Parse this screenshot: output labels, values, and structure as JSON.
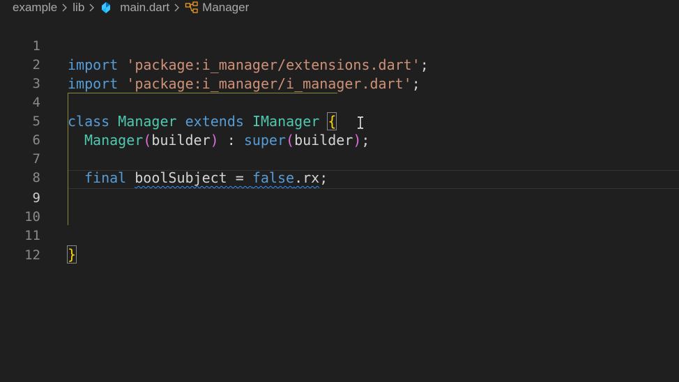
{
  "breadcrumb": {
    "items": [
      "example",
      "lib",
      "main.dart",
      "Manager"
    ],
    "icons": {
      "file": "dart-file-icon",
      "symbol": "class-symbol-icon",
      "separator": "chevron-right-icon"
    }
  },
  "editor": {
    "line_numbers": [
      "1",
      "2",
      "3",
      "4",
      "5",
      "6",
      "7",
      "8",
      "9",
      "10",
      "11",
      "12"
    ],
    "active_line": 9,
    "code": {
      "l1": {
        "kw": "import",
        "str": "'package:i_manager/extensions.dart'",
        "end": ";"
      },
      "l2": {
        "kw": "import",
        "str": "'package:i_manager/i_manager.dart'",
        "end": ";"
      },
      "l4": {
        "kw1": "class",
        "type1": "Manager",
        "kw2": "extends",
        "type2": "IManager",
        "brace": "{"
      },
      "l5": {
        "type": "Manager",
        "p_open": "(",
        "arg": "builder",
        "p_close": ")",
        "colon": " : ",
        "sup": "super",
        "p2_open": "(",
        "arg2": "builder",
        "p2_close": ")",
        "end": ";"
      },
      "l7": {
        "kw": "final",
        "name": "boolSubject",
        "eq": " = ",
        "val": "false",
        "prop": ".rx",
        "end": ";"
      },
      "l11": {
        "brace": "}"
      }
    },
    "colors": {
      "keyword": "#569cd6",
      "string": "#ce9178",
      "type": "#4ec9b0",
      "bracket_yellow": "#ffd700",
      "bracket_purple": "#da70d6",
      "background": "#1f1f1f"
    }
  }
}
